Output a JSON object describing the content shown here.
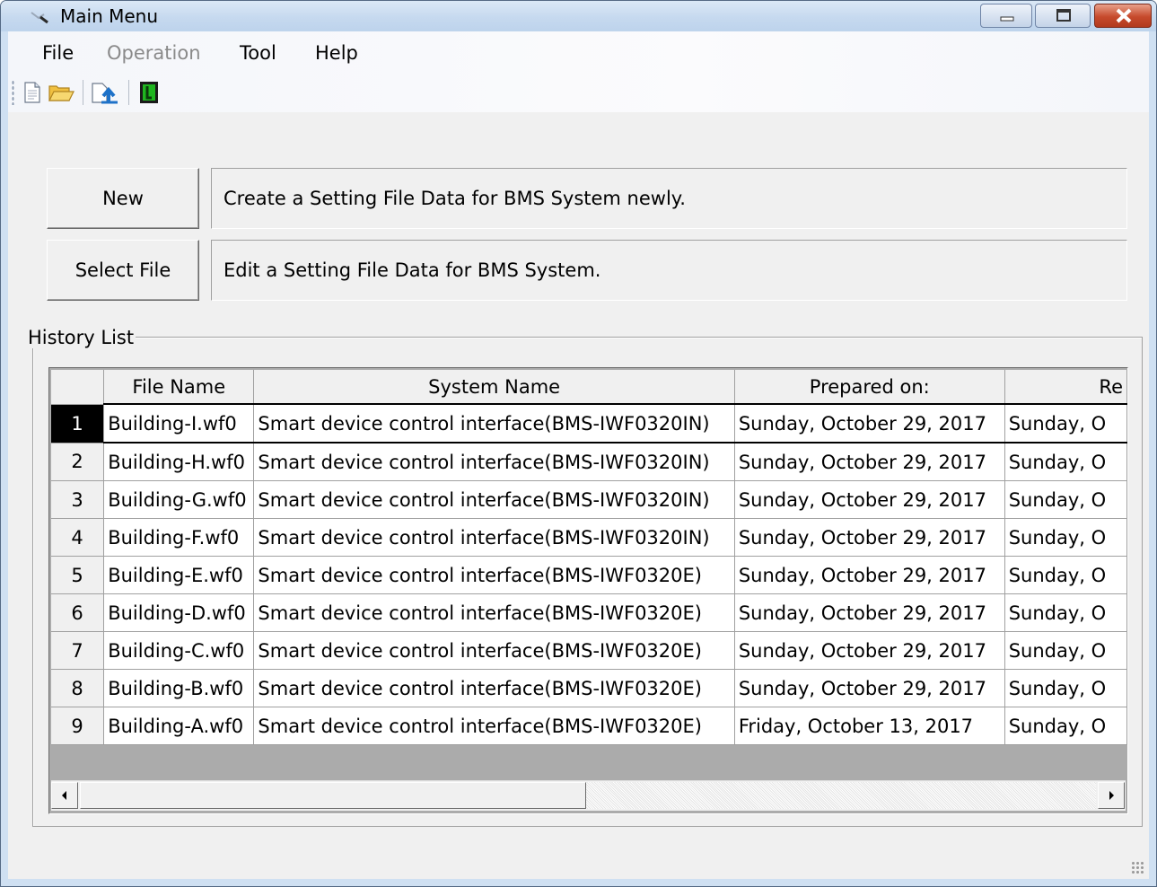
{
  "window": {
    "title": "Main Menu",
    "controls": {
      "minimize": "minimize",
      "maximize": "maximize",
      "close": "close"
    }
  },
  "menu": [
    {
      "label": "File",
      "enabled": true
    },
    {
      "label": "Operation",
      "enabled": false
    },
    {
      "label": "Tool",
      "enabled": true
    },
    {
      "label": "Help",
      "enabled": true
    }
  ],
  "toolbar": {
    "icons": [
      "new-document-icon",
      "open-folder-icon",
      "upload-icon",
      "terminal-icon"
    ]
  },
  "actions": {
    "new_label": "New",
    "new_desc": "Create a Setting File Data for BMS System newly.",
    "select_label": "Select File",
    "select_desc": "Edit a Setting File Data for BMS System."
  },
  "history": {
    "title": "History List",
    "columns": [
      "File Name",
      "System Name",
      "Prepared on:",
      "Re"
    ],
    "selected_row": 1,
    "rows": [
      {
        "num": "1",
        "file": "Building-I.wf0",
        "system": "Smart device control interface(BMS-IWF0320IN)",
        "prepared": "Sunday, October 29, 2017",
        "revised": "Sunday, O"
      },
      {
        "num": "2",
        "file": "Building-H.wf0",
        "system": "Smart device control interface(BMS-IWF0320IN)",
        "prepared": "Sunday, October 29, 2017",
        "revised": "Sunday, O"
      },
      {
        "num": "3",
        "file": "Building-G.wf0",
        "system": "Smart device control interface(BMS-IWF0320IN)",
        "prepared": "Sunday, October 29, 2017",
        "revised": "Sunday, O"
      },
      {
        "num": "4",
        "file": "Building-F.wf0",
        "system": "Smart device control interface(BMS-IWF0320IN)",
        "prepared": "Sunday, October 29, 2017",
        "revised": "Sunday, O"
      },
      {
        "num": "5",
        "file": "Building-E.wf0",
        "system": "Smart device control interface(BMS-IWF0320E)",
        "prepared": "Sunday, October 29, 2017",
        "revised": "Sunday, O"
      },
      {
        "num": "6",
        "file": "Building-D.wf0",
        "system": "Smart device control interface(BMS-IWF0320E)",
        "prepared": "Sunday, October 29, 2017",
        "revised": "Sunday, O"
      },
      {
        "num": "7",
        "file": "Building-C.wf0",
        "system": "Smart device control interface(BMS-IWF0320E)",
        "prepared": "Sunday, October 29, 2017",
        "revised": "Sunday, O"
      },
      {
        "num": "8",
        "file": "Building-B.wf0",
        "system": "Smart device control interface(BMS-IWF0320E)",
        "prepared": "Sunday, October 29, 2017",
        "revised": "Sunday, O"
      },
      {
        "num": "9",
        "file": "Building-A.wf0",
        "system": "Smart device control interface(BMS-IWF0320E)",
        "prepared": "Friday, October 13, 2017",
        "revised": "Sunday, O"
      }
    ]
  },
  "colors": {
    "titlebar": "#c6d9ef",
    "selection": "#000000",
    "close_button": "#c64a2c"
  }
}
